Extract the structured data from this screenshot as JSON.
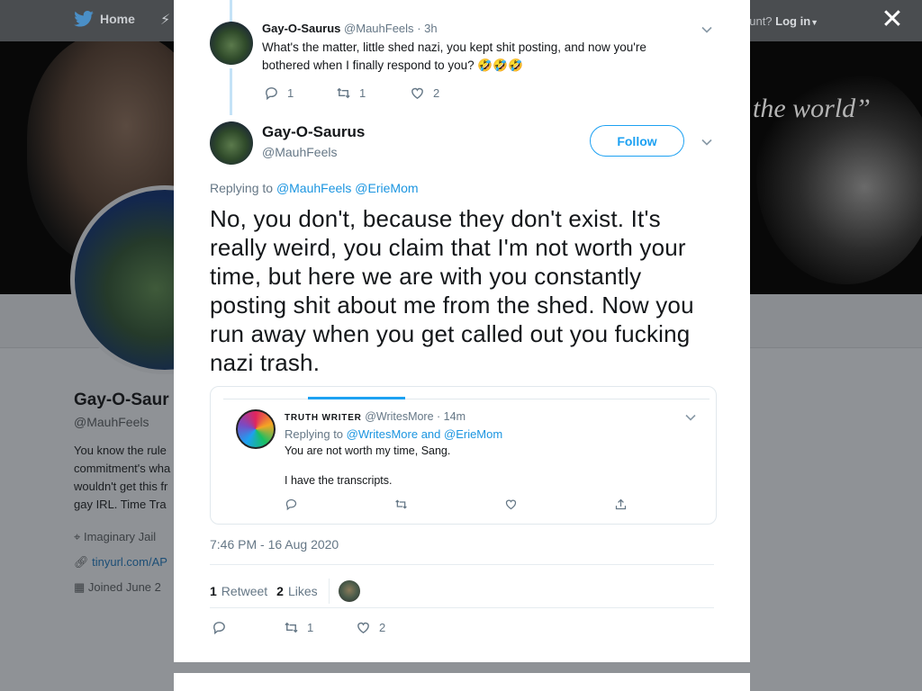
{
  "background": {
    "nav_home_label": "Home",
    "login_prompt": "ccount?",
    "login_label": "Log in",
    "banner_quote": "the world”",
    "profile": {
      "name": "Gay-O-Saur",
      "handle": "@MauhFeels",
      "bio_lines": [
        "You know the rule",
        "commitment's wha",
        "wouldn't get this fr",
        "gay IRL. Time Tra"
      ],
      "location": "Imaginary Jail",
      "link": "tinyurl.com/AP",
      "joined": "Joined June 2"
    }
  },
  "close_label": "✕",
  "previous_tweet": {
    "name": "Gay-O-Saurus",
    "handle": "@MauhFeels",
    "time": "· 3h",
    "text": "What's the matter, little shed nazi, you kept shit posting, and now you're bothered when I finally respond to you? 🤣🤣🤣",
    "replies": "1",
    "retweets": "1",
    "likes": "2"
  },
  "main_tweet": {
    "name": "Gay-O-Saurus",
    "handle": "@MauhFeels",
    "follow_label": "Follow",
    "replying_prefix": "Replying to",
    "replying_to_1": "@MauhFeels",
    "replying_to_2": "@ErieMom",
    "text": "No, you don't, because they don't exist. It's really weird, you claim that I'm not worth your time, but here we are with you constantly posting shit about me from the shed. Now you run away when you get called out you fucking nazi trash.",
    "timestamp": "7:46 PM - 16 Aug 2020",
    "retweet_count": "1",
    "retweet_label": "Retweet",
    "like_count": "2",
    "like_label": "Likes",
    "action_retweets": "1",
    "action_likes": "2"
  },
  "embedded_image": {
    "name": "TRUTH WRITER",
    "handle": "@WritesMore",
    "time": "· 14m",
    "replying_prefix": "Replying to",
    "replying_to": "@WritesMore and @ErieMom",
    "line1": "You are not worth my time, Sang.",
    "line2": "I have the transcripts."
  },
  "colors": {
    "accent": "#1da1f2",
    "link": "#1b95e0",
    "muted": "#657786",
    "overlay_bg": "#8f9296"
  }
}
